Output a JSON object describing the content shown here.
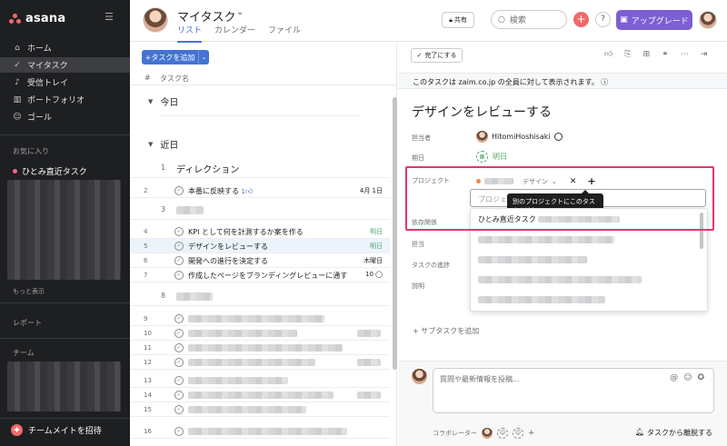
{
  "sidebar": {
    "logo": "asana",
    "nav": [
      {
        "label": "ホーム",
        "icon": "home-icon"
      },
      {
        "label": "マイタスク",
        "icon": "check-circle-icon"
      },
      {
        "label": "受信トレイ",
        "icon": "bell-icon"
      },
      {
        "label": "ポートフォリオ",
        "icon": "bar-chart-icon"
      },
      {
        "label": "ゴール",
        "icon": "person-icon"
      }
    ],
    "favorites_title": "お気に入り",
    "favorite_item": "ひとみ直近タスク",
    "show_more": "もっと表示",
    "reports_title": "レポート",
    "teams_title": "チーム",
    "invite": "チームメイトを招待"
  },
  "header": {
    "title": "マイタスク",
    "tabs": [
      "リスト",
      "カレンダー",
      "ファイル"
    ],
    "share": "共有",
    "search_placeholder": "検索",
    "upgrade": "アップグレード"
  },
  "list": {
    "add_task": "タスクを追加",
    "col_num": "#",
    "col_name": "タスク名",
    "section_today": "今日",
    "section_soon": "近日",
    "group1": {
      "num": "1",
      "label": "ディレクション"
    },
    "rows": [
      {
        "num": "2",
        "text": "本番に反映する",
        "extra": "1",
        "due": "4月 1日"
      },
      {
        "num": "4",
        "text": "KPI として何を計測するか案を作る",
        "due": "明日"
      },
      {
        "num": "5",
        "text": "デザインをレビューする",
        "due": "明日"
      },
      {
        "num": "6",
        "text": "開発への進行を決定する",
        "due": "木曜日"
      },
      {
        "num": "7",
        "text": "作成したページをブランディングレビューに通す",
        "extra": "10"
      }
    ],
    "group3": "3",
    "group8": "8",
    "blurred_nums": [
      "9",
      "10",
      "11",
      "12",
      "13",
      "14",
      "15",
      "16"
    ]
  },
  "detail": {
    "complete": "完了にする",
    "notice": "このタスクは zaim.co.jp の全員に対して表示されます。",
    "title": "デザインをレビューする",
    "label_assignee": "担当者",
    "assignee": "HitomiHoshisaki",
    "label_due": "期日",
    "due": "明日",
    "label_project": "プロジェクト",
    "project_section": "デザイン",
    "project_input_placeholder": "プロジェ",
    "tooltip": "別のプロジェクトにこのタスクを追加",
    "label_dependency": "依存関係",
    "label_owner": "担当",
    "label_progress": "タスクの進捗",
    "label_desc": "説明",
    "dropdown_first": "ひとみ直近タスク",
    "add_subtask": "サブタスクを追加",
    "comment_placeholder": "質問や最新情報を投稿...",
    "collaborators": "コラボレーター",
    "leave": "タスクから離脱する"
  },
  "colors": {
    "accent": "#4573d2",
    "brand": "#f06a6a",
    "highlight": "#e8336f",
    "green": "#4ea868",
    "upgrade": "#7c5fd3"
  }
}
